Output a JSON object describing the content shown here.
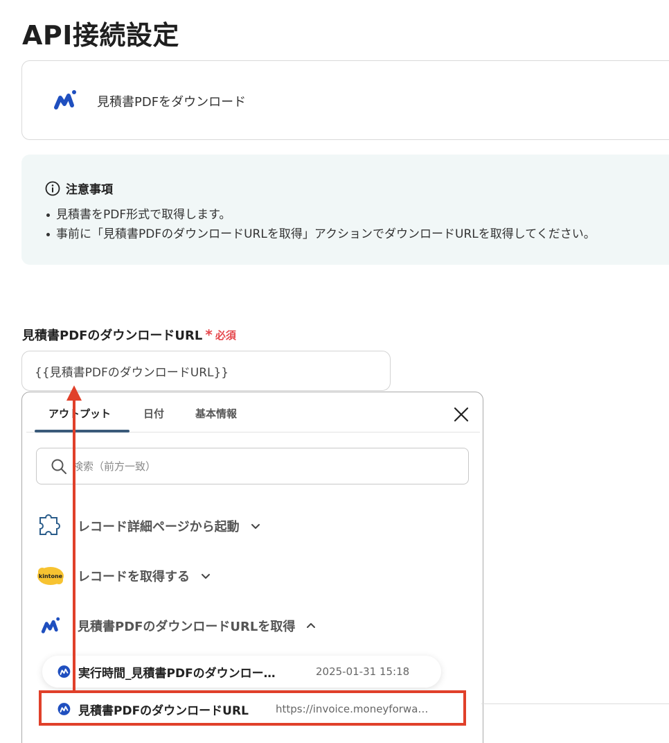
{
  "page": {
    "title": "API接続設定"
  },
  "action": {
    "label": "見積書PDFをダウンロード",
    "logo_icon": "moneyforward-logo-icon"
  },
  "notice": {
    "heading": "注意事項",
    "items": [
      "見積書をPDF形式で取得します。",
      "事前に「見積書PDFのダウンロードURLを取得」アクションでダウンロードURLを取得してください。"
    ]
  },
  "field": {
    "label": "見積書PDFのダウンロードURL",
    "required_mark": "*",
    "required_text": "必須",
    "value": "{{見積書PDFのダウンロードURL}}"
  },
  "panel": {
    "tabs": [
      "アウトプット",
      "日付",
      "基本情報"
    ],
    "active_tab": 0,
    "search_placeholder": "検索（前方一致）",
    "groups": [
      {
        "title": "レコード詳細ページから起動",
        "icon": "puzzle-icon",
        "expanded": false
      },
      {
        "title": "レコードを取得する",
        "icon": "kintone-logo-icon",
        "icon_text": "kintone",
        "expanded": false
      },
      {
        "title": "見積書PDFのダウンロードURLを取得",
        "icon": "moneyforward-logo-icon",
        "expanded": true
      }
    ],
    "items": [
      {
        "name": "実行時間_見積書PDFのダウンロー…",
        "value": "2025-01-31 15:18"
      },
      {
        "name": "見積書PDFのダウンロードURL",
        "value": "https://invoice.moneyforwa…"
      }
    ]
  },
  "colors": {
    "accent": "#3a5a7a",
    "required": "#e5484d",
    "annotation": "#e0402a",
    "brand": "#1f4fbf"
  }
}
